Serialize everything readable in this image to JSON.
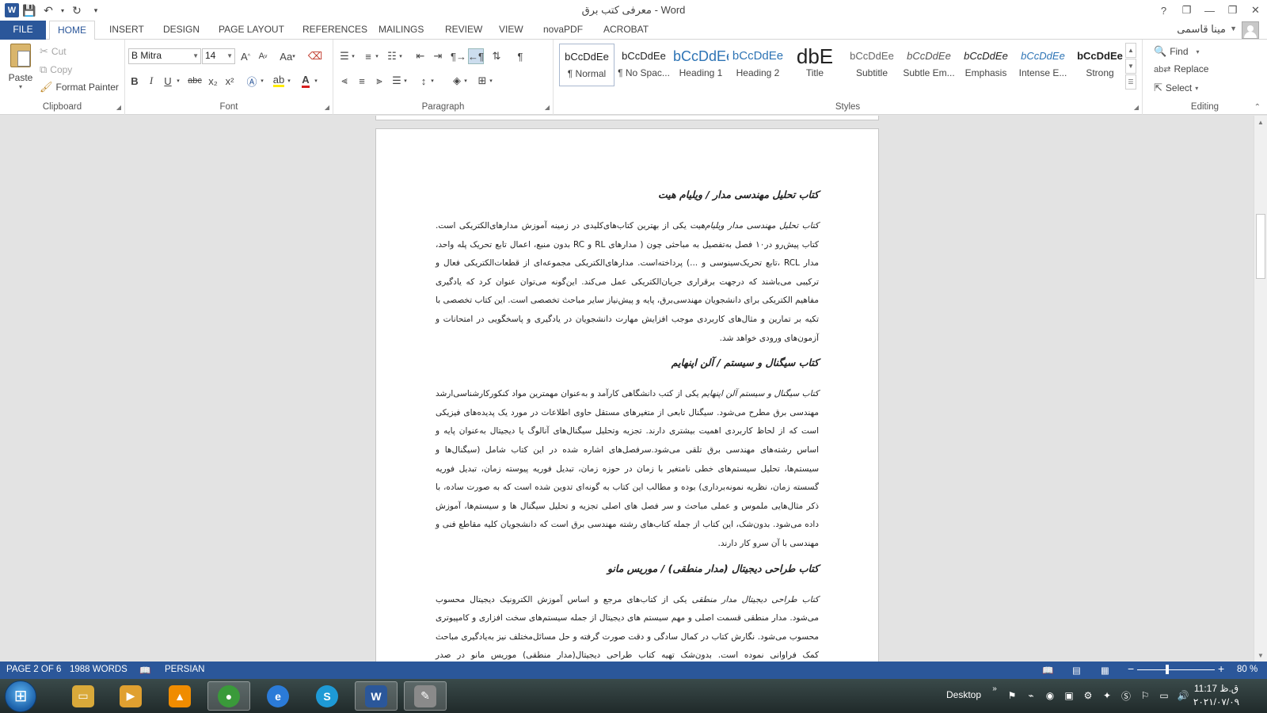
{
  "window": {
    "title": "معرفی کتب برق - Word",
    "controls": [
      "?",
      "❐",
      "—",
      "❐",
      "✕"
    ]
  },
  "qat": {
    "save": "save-icon",
    "undo": "undo-icon",
    "redo": "redo-icon",
    "customize": "customize-icon"
  },
  "tabs": [
    "FILE",
    "HOME",
    "INSERT",
    "DESIGN",
    "PAGE LAYOUT",
    "REFERENCES",
    "MAILINGS",
    "REVIEW",
    "VIEW",
    "novaPDF",
    "ACROBAT"
  ],
  "active_tab": "HOME",
  "user": {
    "name": "مینا قاسمی"
  },
  "ribbon": {
    "clipboard": {
      "label": "Clipboard",
      "paste": "Paste",
      "cut": "Cut",
      "copy": "Copy",
      "format_painter": "Format Painter"
    },
    "font": {
      "label": "Font",
      "family": "B Mitra",
      "size": "14",
      "grow": "A",
      "shrink": "A",
      "change_case": "Aa",
      "bold": "B",
      "italic": "I",
      "underline": "U",
      "strike": "abc",
      "subscript": "x₂",
      "superscript": "x²"
    },
    "paragraph": {
      "label": "Paragraph"
    },
    "styles": {
      "label": "Styles",
      "items": [
        {
          "sample": "bCcDdEe",
          "name": "¶ Normal"
        },
        {
          "sample": "bCcDdEe",
          "name": "¶ No Spac..."
        },
        {
          "sample": "bCcDdEe",
          "name": "Heading 1"
        },
        {
          "sample": "bCcDdEe",
          "name": "Heading 2"
        },
        {
          "sample": "dbE",
          "name": "Title"
        },
        {
          "sample": "bCcDdEe",
          "name": "Subtitle"
        },
        {
          "sample": "bCcDdEe",
          "name": "Subtle Em..."
        },
        {
          "sample": "bCcDdEe",
          "name": "Emphasis"
        },
        {
          "sample": "bCcDdEe",
          "name": "Intense E..."
        },
        {
          "sample": "bCcDdEe",
          "name": "Strong"
        }
      ]
    },
    "editing": {
      "label": "Editing",
      "find": "Find",
      "replace": "Replace",
      "select": "Select"
    }
  },
  "document": {
    "sections": [
      {
        "heading": "کتاب تحلیل مهندسی مدار / ویلیام هیت",
        "lead": "کتاب تحلیل مهندسی مدار ویلیام‌هیت",
        "body": " یکی از بهترین کتاب‌های‌کلیدی در زمینه آموزش مدارهای‌الکتریکی است. کتاب پیش‌رو در۱۰ فصل به‌تفصیل به مباحثی چون ( مدارهای RL و RC بدون منبع، اعمال تابع تحریک پله واحد، مدار RCL ،تابع تحریک‌سینوسی و ...) پرداخته‌است. مدارهای‌الکتریکی مجموعه‌ای از قطعات‌الکتریکی فعال و ترکیبی می‌باشند که درجهت برقراری جریان‌الکتریکی عمل می‌کند. این‌گونه می‌توان عنوان کرد که یادگیری مفاهیم الکتریکی برای دانشجویان مهندسی‌برق، پایه و پیش‌نیاز سایر مباحث تخصصی است. این کتاب تخصصی با تکیه بر تمارین و مثال‌های کاربردی موجب افزایش مهارت دانشجویان در یادگیری و پاسخگویی در امتحانات و آزمون‌های ورودی خواهد شد."
      },
      {
        "heading": "کتاب سیگنال و سیستم / آلن اپنهایم",
        "lead": "کتاب سیگنال و سیستم آلن اپنهایم",
        "body": " یکی از کتب دانشگاهی کارآمد و به‌عنوان مهمترین مواد کنکورکارشناسی‌ارشد مهندسی برق مطرح می‌شود. سیگنال تابعی از متغیرهای مستقل حاوی اطلاعات در مورد یک پدیده‌های فیزیکی است که از لحاظ کاربردی اهمیت بیشتری دارند. تجزیه وتحلیل سیگنال‌های آنالوگ یا دیجیتال به‌عنوان پایه و اساس رشته‌های مهندسی برق تلقی می‌شود.سرفصل‌های اشاره شده در این کتاب شامل (سیگنال‌ها و سیستم‌ها، تحلیل سیستم‌های خطی نامتغیر با زمان در حوزه زمان، تبدیل فوریه پیوسته زمان، تبدیل فوریه گسسته زمان، نظریه نمونه‌برداری) بوده و مطالب این کتاب به گونه‌ای تدوین شده است که به صورت ساده، با ذکر مثال‌هایی ملموس و عملی مباحث و سر فصل های اصلی تجزیه و تحلیل سیگنال ها و سیستم‌ها، آموزش داده می‌شود. بدون‌شک، این کتاب از جمله کتاب‌های رشته مهندسی برق است که دانشجویان کلیه مقاطع فنی و مهندسی با آن سرو کار دارند."
      },
      {
        "heading": "کتاب طراحی دیجیتال (مدار منطقی) / موریس مانو",
        "lead": "کتاب طراحی دیجیتال مدار منطقی",
        "body": " یکی از کتاب‌های مرجع و اساس آموزش الکترونیک دیجیتال محسوب می‌شود. مدار منطقی قسمت اصلی و مهم سیستم های دیجیتال از جمله سیستم‌های سخت افزاری و کامپیوتری محسوب می‌شود. نگارش کتاب در کمال سادگی و دقت صورت گرفته و حل مسائل‌مختلف نیز به‌یادگیری مباحث کمک فراوانی نموده است. بدون‌شک تهیه کتاب طراحی دیجیتال(مدار منطقی) موریس مانو در صدر پرفروش‌ترین کتب مهندسی برق قرار خواهد داشت."
      }
    ]
  },
  "status": {
    "page": "PAGE 2 OF 6",
    "words": "1988 WORDS",
    "language": "PERSIAN",
    "zoom": "80 %",
    "zoom_value": 80
  },
  "taskbar": {
    "apps": [
      {
        "name": "explorer",
        "icon": "folder-icon",
        "color": "#d9a93a"
      },
      {
        "name": "media",
        "icon": "media-player-icon",
        "color": "#d9a93a"
      },
      {
        "name": "vlc",
        "icon": "vlc-icon",
        "color": "#f08c00"
      },
      {
        "name": "chrome",
        "icon": "chrome-icon",
        "color": "#3a9a3a"
      },
      {
        "name": "ie",
        "icon": "ie-icon",
        "color": "#2b7bd8"
      },
      {
        "name": "skype",
        "icon": "skype-icon",
        "color": "#1e9ad6"
      },
      {
        "name": "word",
        "icon": "word-icon",
        "color": "#2b579a"
      },
      {
        "name": "paint",
        "icon": "paint-icon",
        "color": "#8a8a8a"
      }
    ],
    "desktop_label": "Desktop",
    "time": "11:17 ق.ظ",
    "date": "۲۰۲۱/۰۷/۰۹"
  }
}
